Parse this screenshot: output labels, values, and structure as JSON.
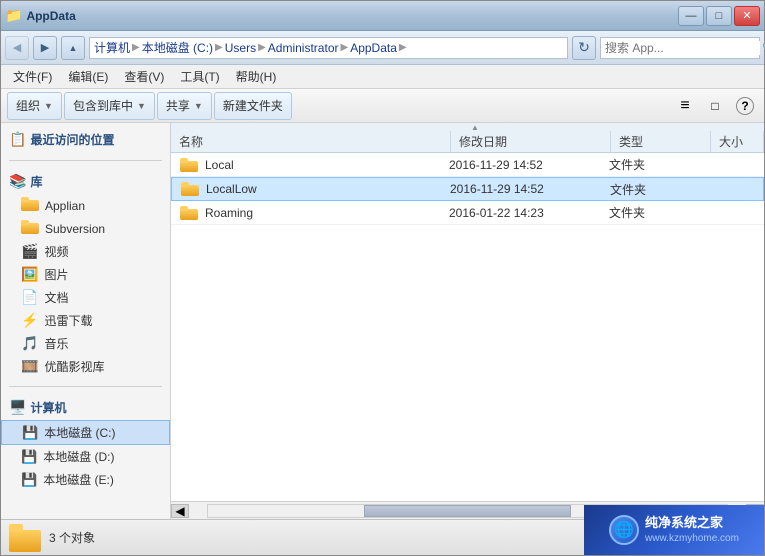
{
  "window": {
    "title": "AppData",
    "controls": {
      "minimize": "—",
      "maximize": "□",
      "close": "✕"
    }
  },
  "addressbar": {
    "back_tooltip": "后退",
    "forward_tooltip": "前进",
    "up_tooltip": "上级",
    "path": [
      {
        "label": "计算机"
      },
      {
        "label": "本地磁盘 (C:)"
      },
      {
        "label": "Users"
      },
      {
        "label": "Administrator"
      },
      {
        "label": "AppData"
      }
    ],
    "refresh": "↻",
    "search_placeholder": "搜索 App..."
  },
  "menubar": {
    "items": [
      {
        "label": "文件(F)"
      },
      {
        "label": "编辑(E)"
      },
      {
        "label": "查看(V)"
      },
      {
        "label": "工具(T)"
      },
      {
        "label": "帮助(H)"
      }
    ]
  },
  "toolbar": {
    "organize": "组织",
    "include": "包含到库中",
    "share": "共享",
    "new_folder": "新建文件夹",
    "view_icon": "≡",
    "view_toggle": "□",
    "help": "?"
  },
  "sidebar": {
    "recent_label": "最近访问的位置",
    "library_label": "库",
    "library_items": [
      {
        "label": "Applian",
        "icon": "folder"
      },
      {
        "label": "Subversion",
        "icon": "folder"
      },
      {
        "label": "视频",
        "icon": "video-library"
      },
      {
        "label": "图片",
        "icon": "photo-library"
      },
      {
        "label": "文档",
        "icon": "doc-library"
      },
      {
        "label": "迅雷下载",
        "icon": "folder"
      },
      {
        "label": "音乐",
        "icon": "music-library"
      },
      {
        "label": "优酷影视库",
        "icon": "folder"
      }
    ],
    "computer_label": "计算机",
    "drives": [
      {
        "label": "本地磁盘 (C:)",
        "selected": true
      },
      {
        "label": "本地磁盘 (D:)"
      },
      {
        "label": "本地磁盘 (E:)"
      }
    ]
  },
  "file_list": {
    "columns": {
      "name": "名称",
      "date": "修改日期",
      "type": "类型",
      "size": "大小"
    },
    "files": [
      {
        "name": "Local",
        "date": "2016-11-29 14:52",
        "type": "文件夹",
        "size": ""
      },
      {
        "name": "LocalLow",
        "date": "2016-11-29 14:52",
        "type": "文件夹",
        "size": "",
        "selected": true
      },
      {
        "name": "Roaming",
        "date": "2016-01-22 14:23",
        "type": "文件夹",
        "size": ""
      }
    ]
  },
  "statusbar": {
    "count": "3 个对象"
  },
  "watermark": {
    "main": "纯净系统之家",
    "sub": "www.kzmyhome.com"
  }
}
